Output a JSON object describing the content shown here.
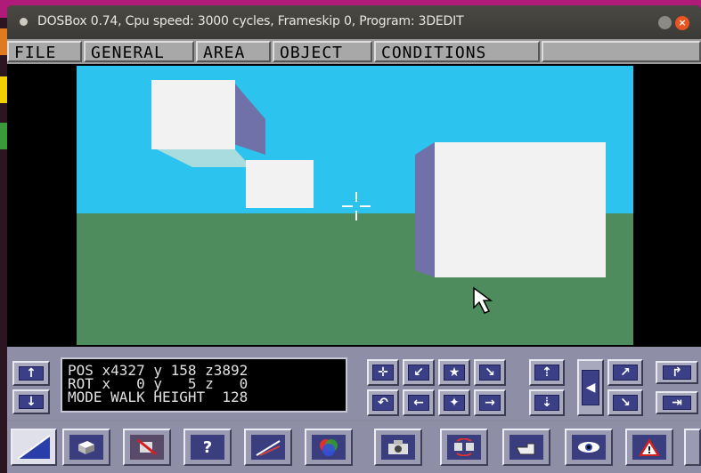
{
  "window": {
    "title": "DOSBox 0.74, Cpu speed:    3000 cycles, Frameskip  0, Program:   3DEDIT",
    "close_glyph": "×"
  },
  "menu": [
    {
      "label": "FILE"
    },
    {
      "label": "GENERAL"
    },
    {
      "label": "AREA"
    },
    {
      "label": "OBJECT"
    },
    {
      "label": "CONDITIONS"
    }
  ],
  "status": {
    "line1": "POS x4327 y 158 z3892",
    "line2": "ROT x   0 y   5 z   0",
    "line3": "MODE WALK HEIGHT  128"
  },
  "colors": {
    "sky": "#2cc3ee",
    "ground": "#4f8c5d",
    "cube_face": "#f2f2f2",
    "cube_side": "#6f71a8",
    "shadow": "#a9dcdf",
    "menu_bg": "#9b9b9b",
    "panel_bg": "#8e8fa6",
    "button_face": "#3a3f86"
  },
  "nav_buttons": {
    "up": "↑",
    "down": "↓",
    "crosshair": "✛",
    "down_left": "↙",
    "star": "★",
    "down_right": "↘",
    "rotate": "↶",
    "left": "←",
    "star_down": "✦",
    "right": "→",
    "step_up": "⇡",
    "step_down": "⇣",
    "look_left": "◀",
    "diag_up": "↗",
    "diag_down": "↘",
    "turn_right": "↱",
    "exit_right": "⇥"
  },
  "tools": [
    {
      "icon": "select-icon"
    },
    {
      "icon": "cube-icon"
    },
    {
      "icon": "delete-object-icon"
    },
    {
      "icon": "help-icon",
      "glyph": "?"
    },
    {
      "icon": "line-icon"
    },
    {
      "icon": "color-wheel-icon"
    },
    {
      "icon": "camera-icon"
    },
    {
      "icon": "swap-icon"
    },
    {
      "icon": "hand-pointer-icon"
    },
    {
      "icon": "eye-icon"
    },
    {
      "icon": "warning-icon",
      "glyph": "!"
    }
  ]
}
